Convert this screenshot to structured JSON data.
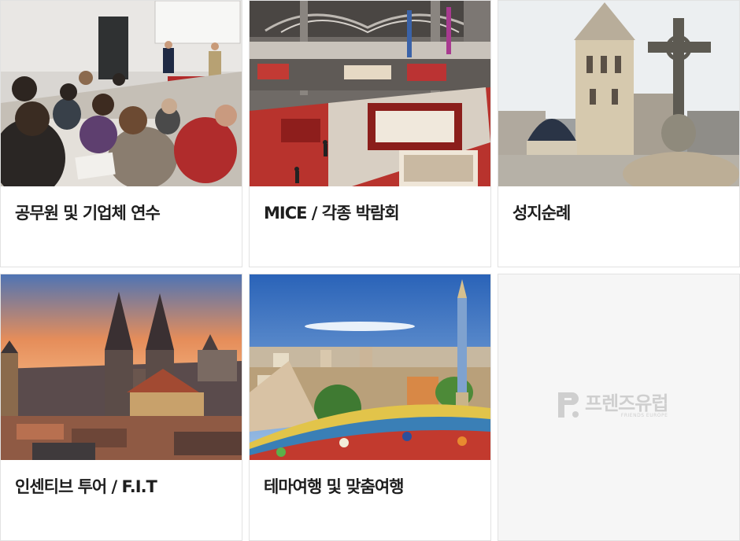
{
  "cards": [
    {
      "label": "공무원 및 기업체 연수",
      "image": "seminar-lecture-photo"
    },
    {
      "label": "MICE / 각종 박람회",
      "image": "exhibition-hall-photo"
    },
    {
      "label": "성지순례",
      "image": "jerusalem-church-cross-photo"
    },
    {
      "label": "인센티브 투어 / F.I.T",
      "image": "prague-sunset-photo"
    },
    {
      "label": "테마여행 및 맞춤여행",
      "image": "barcelona-park-guell-photo"
    }
  ],
  "logo": {
    "name": "프렌즈유럽",
    "subtitle": "FRIENDS EUROPE",
    "color": "#cfcfcf"
  }
}
